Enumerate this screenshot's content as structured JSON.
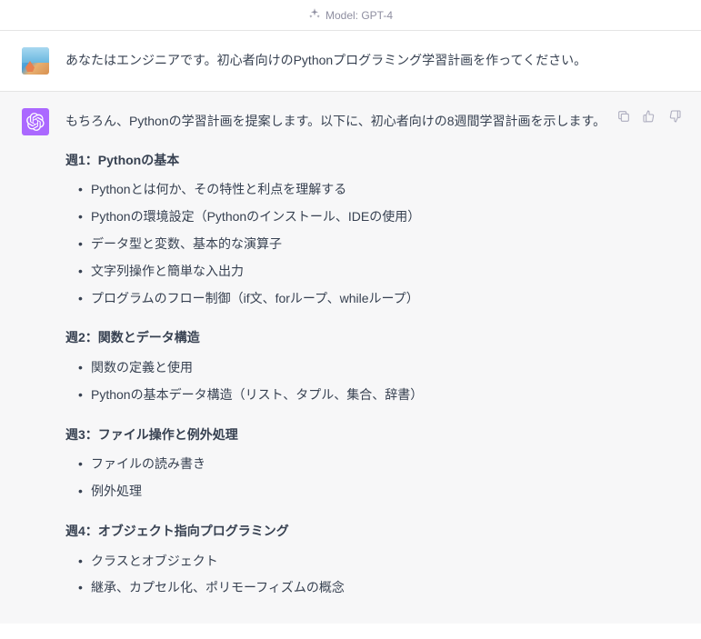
{
  "model_banner": {
    "label": "Model: GPT-4"
  },
  "user_message": {
    "text": "あなたはエンジニアです。初心者向けのPythonプログラミング学習計画を作ってください。"
  },
  "assistant_message": {
    "intro": "もちろん、Pythonの学習計画を提案します。以下に、初心者向けの8週間学習計画を示します。",
    "sections": [
      {
        "heading": "週1：Pythonの基本",
        "items": [
          "Pythonとは何か、その特性と利点を理解する",
          "Pythonの環境設定（Pythonのインストール、IDEの使用）",
          "データ型と変数、基本的な演算子",
          "文字列操作と簡単な入出力",
          "プログラムのフロー制御（if文、forループ、whileループ）"
        ]
      },
      {
        "heading": "週2：関数とデータ構造",
        "items": [
          "関数の定義と使用",
          "Pythonの基本データ構造（リスト、タプル、集合、辞書）"
        ]
      },
      {
        "heading": "週3：ファイル操作と例外処理",
        "items": [
          "ファイルの読み書き",
          "例外処理"
        ]
      },
      {
        "heading": "週4：オブジェクト指向プログラミング",
        "items": [
          "クラスとオブジェクト",
          "継承、カプセル化、ポリモーフィズムの概念"
        ]
      }
    ]
  }
}
